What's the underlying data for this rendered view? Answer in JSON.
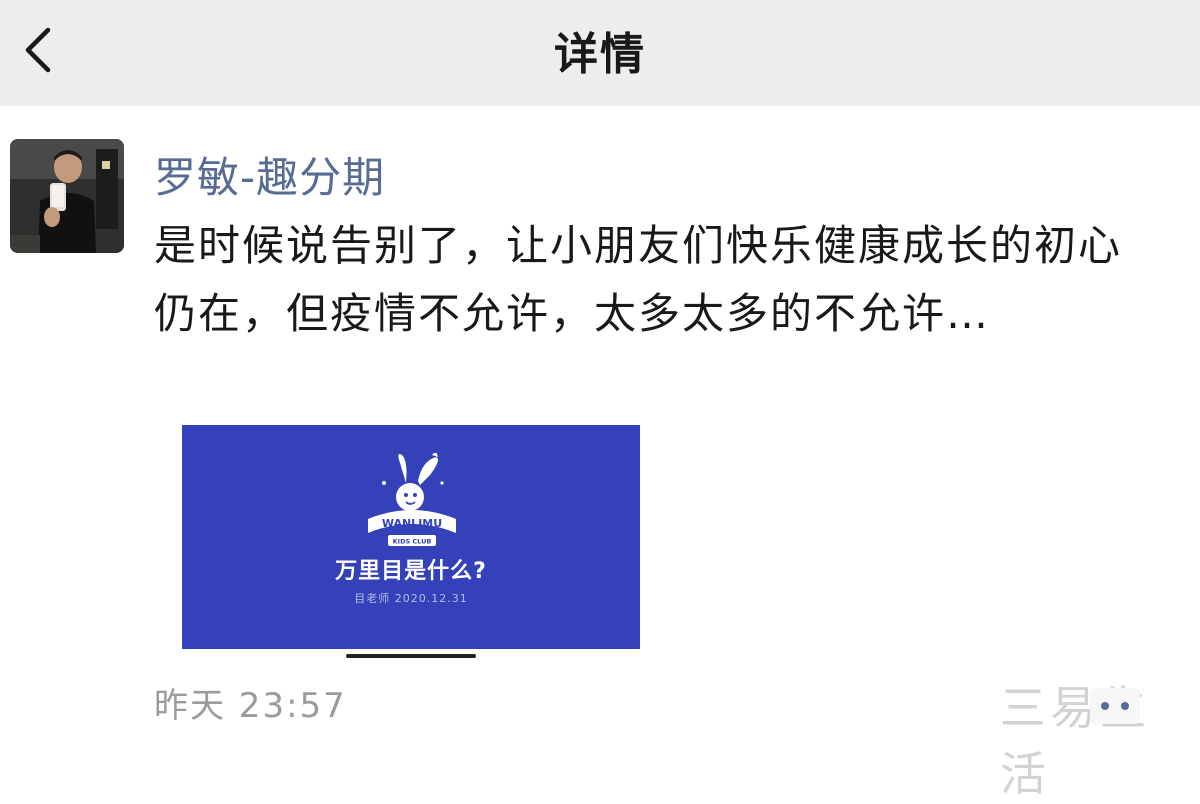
{
  "nav": {
    "back_icon": "chevron-left-icon",
    "title": "详情",
    "background": "#ededed"
  },
  "post": {
    "author": "罗敏-趣分期",
    "author_color": "#576b95",
    "text": "是时候说告别了，让小朋友们快乐健康成长的初心仍在，但疫情不允许，太多太多的不允许…",
    "media": {
      "background": "#3441b8",
      "logo_wordmark": "WANLIMU",
      "logo_subtext": "KIDS CLUB",
      "heading": "万里目是什么?",
      "meta": "目老师 2020.12.31"
    },
    "timestamp": "昨天 23:57",
    "more_icon": "more-dots-icon"
  },
  "watermark": {
    "text": "三易生活"
  }
}
